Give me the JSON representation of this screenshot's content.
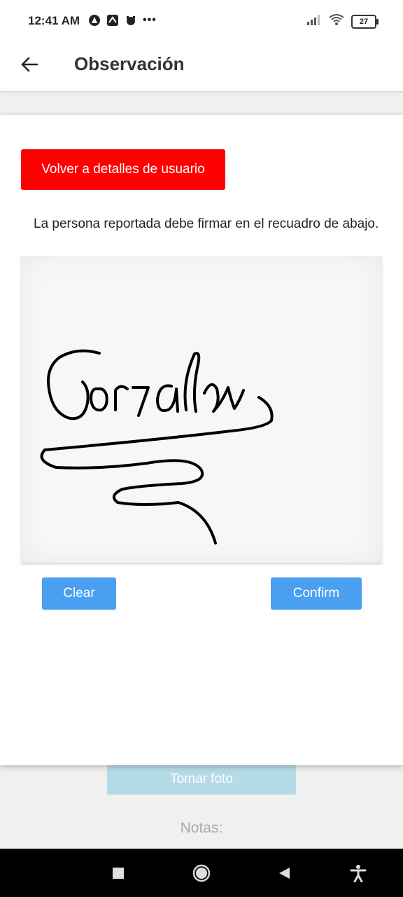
{
  "status_bar": {
    "time": "12:41 AM",
    "more": "•••",
    "battery": "27"
  },
  "app_bar": {
    "title": "Observación"
  },
  "modal": {
    "back_button_label": "Volver a detalles de usuario",
    "instruction": "La persona reportada debe firmar en el recuadro de abajo.",
    "clear_label": "Clear",
    "confirm_label": "Confirm"
  },
  "background": {
    "photo_button_label": "Tomar foto",
    "notes_label": "Notas:"
  },
  "colors": {
    "red_button": "#ff0000",
    "blue_button": "#4a9ff0",
    "photo_button": "#b5dbe7"
  },
  "icons": [
    "back-arrow-icon",
    "signal-icon",
    "wifi-icon",
    "battery-icon",
    "square-icon",
    "circle-icon",
    "triangle-back-icon",
    "accessibility-icon"
  ]
}
